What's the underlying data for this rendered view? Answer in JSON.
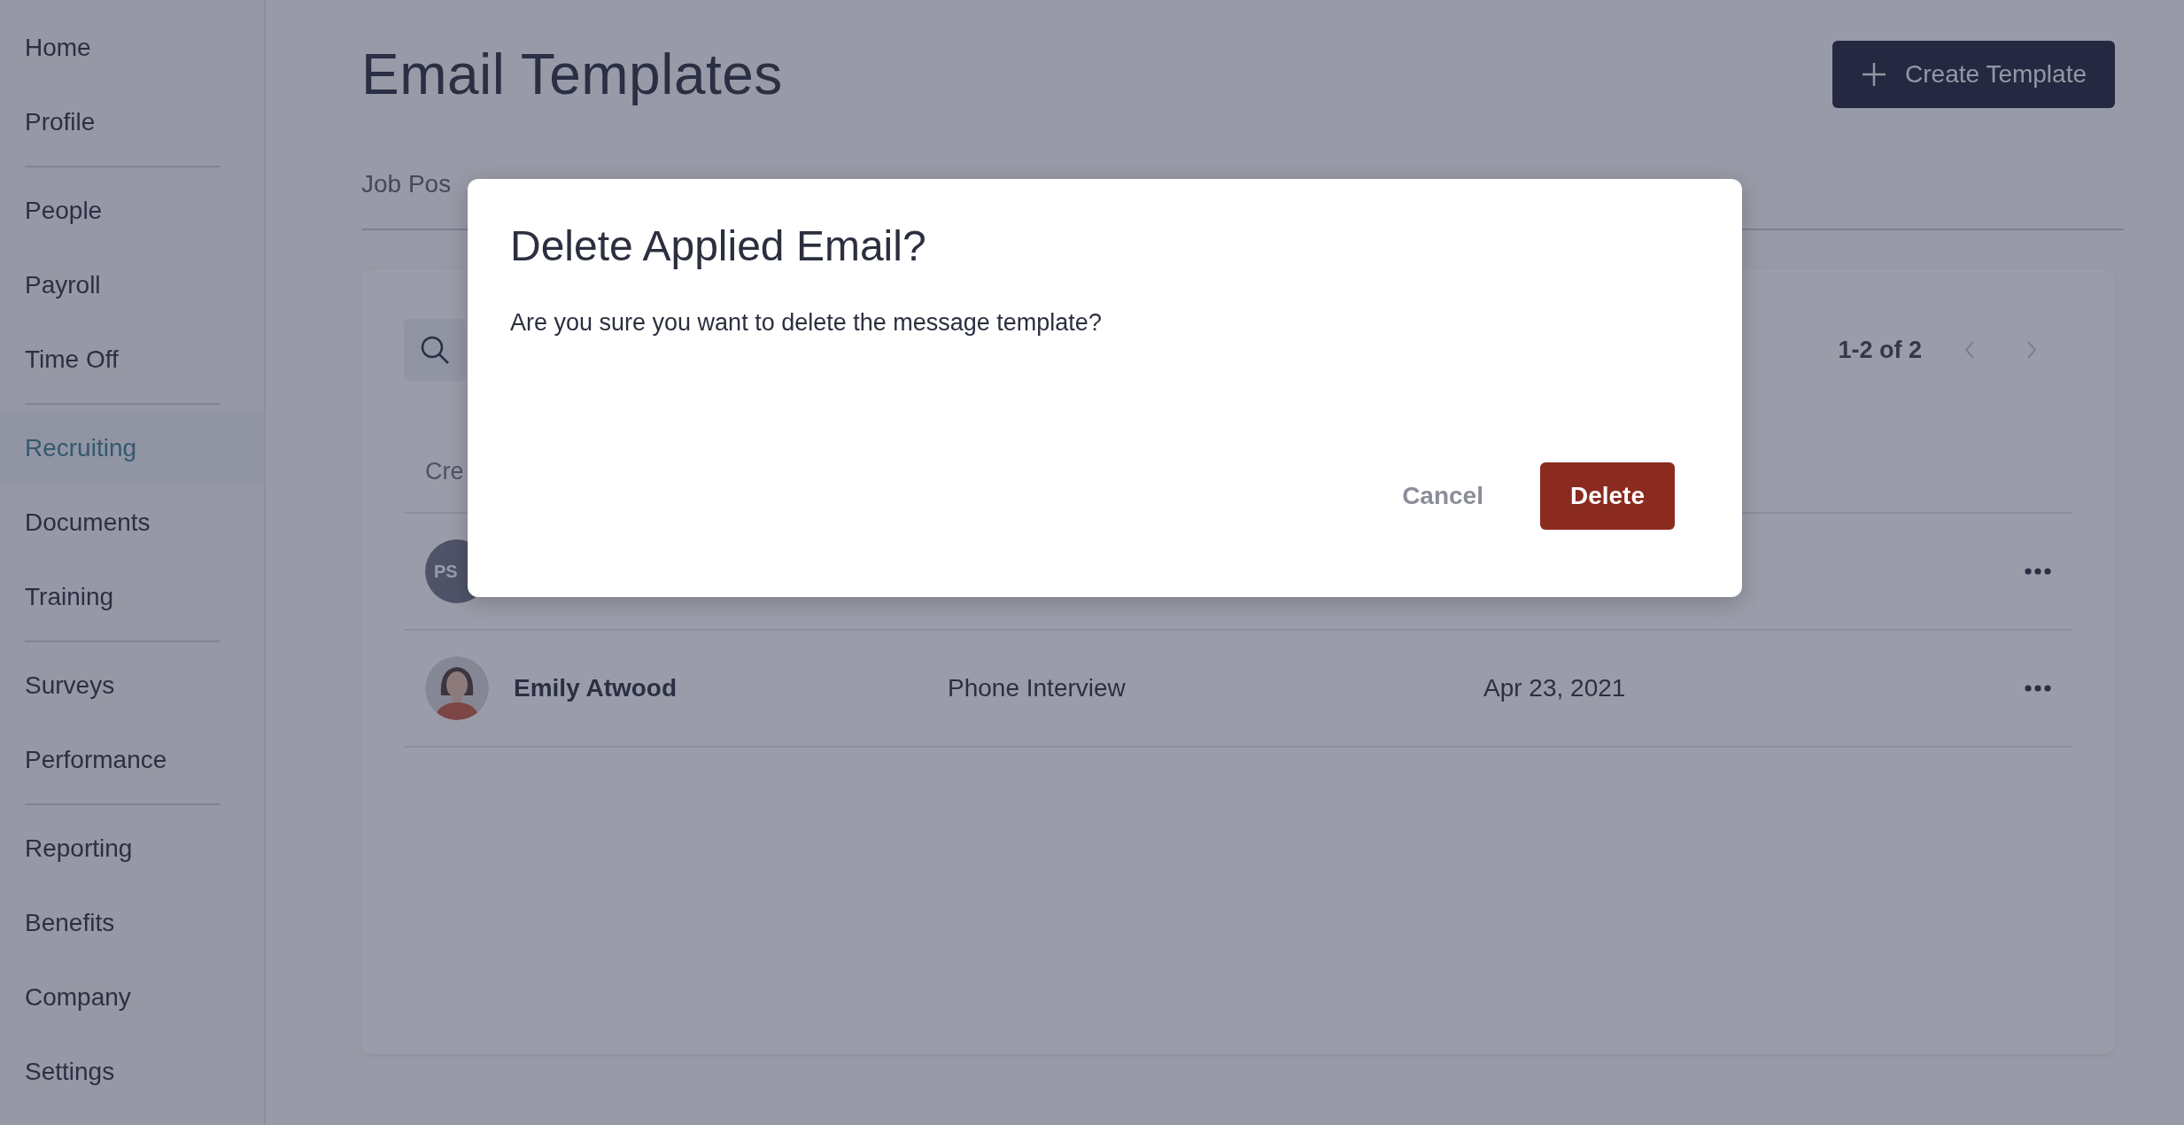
{
  "sidebar": {
    "groups": [
      [
        {
          "label": "Home",
          "selected": false
        },
        {
          "label": "Profile",
          "selected": false
        }
      ],
      [
        {
          "label": "People",
          "selected": false
        },
        {
          "label": "Payroll",
          "selected": false
        },
        {
          "label": "Time Off",
          "selected": false
        }
      ],
      [
        {
          "label": "Recruiting",
          "selected": true
        },
        {
          "label": "Documents",
          "selected": false
        },
        {
          "label": "Training",
          "selected": false
        }
      ],
      [
        {
          "label": "Surveys",
          "selected": false
        },
        {
          "label": "Performance",
          "selected": false
        }
      ],
      [
        {
          "label": "Reporting",
          "selected": false
        },
        {
          "label": "Benefits",
          "selected": false
        },
        {
          "label": "Company",
          "selected": false
        },
        {
          "label": "Settings",
          "selected": false
        }
      ]
    ]
  },
  "page": {
    "title": "Email Templates",
    "create_button": "Create Template",
    "tabs": [
      {
        "label": "Job Pos"
      }
    ]
  },
  "table": {
    "pagination": "1-2 of 2",
    "columns": [
      "Cre"
    ],
    "rows": [
      {
        "avatar": {
          "kind": "initials",
          "text": "PS"
        }
      },
      {
        "name": "Emily Atwood",
        "stage": "Phone Interview",
        "date": "Apr 23, 2021"
      }
    ]
  },
  "dialog": {
    "title": "Delete Applied Email?",
    "message": "Are you sure you want to delete the message template?",
    "buttons": [
      {
        "label": "Cancel",
        "kind": "secondary"
      },
      {
        "label": "Delete",
        "kind": "danger"
      }
    ]
  }
}
